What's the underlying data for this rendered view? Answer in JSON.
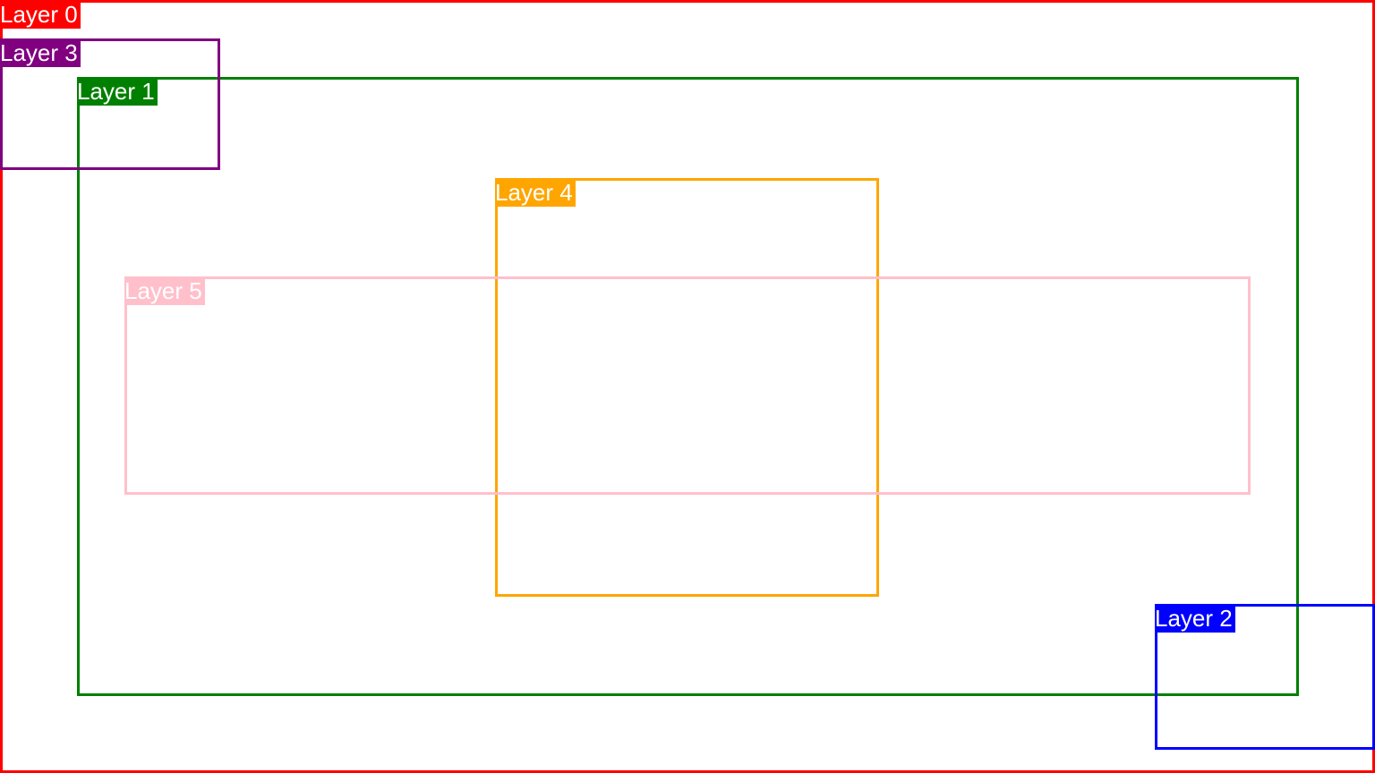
{
  "layers": {
    "layer0": {
      "label": "Layer 0",
      "color": "#ff0000"
    },
    "layer1": {
      "label": "Layer 1",
      "color": "#008000"
    },
    "layer2": {
      "label": "Layer 2",
      "color": "#0000ff"
    },
    "layer3": {
      "label": "Layer 3",
      "color": "#800080"
    },
    "layer4": {
      "label": "Layer 4",
      "color": "#ffa500"
    },
    "layer5": {
      "label": "Layer 5",
      "color": "#ffc0cb"
    }
  }
}
